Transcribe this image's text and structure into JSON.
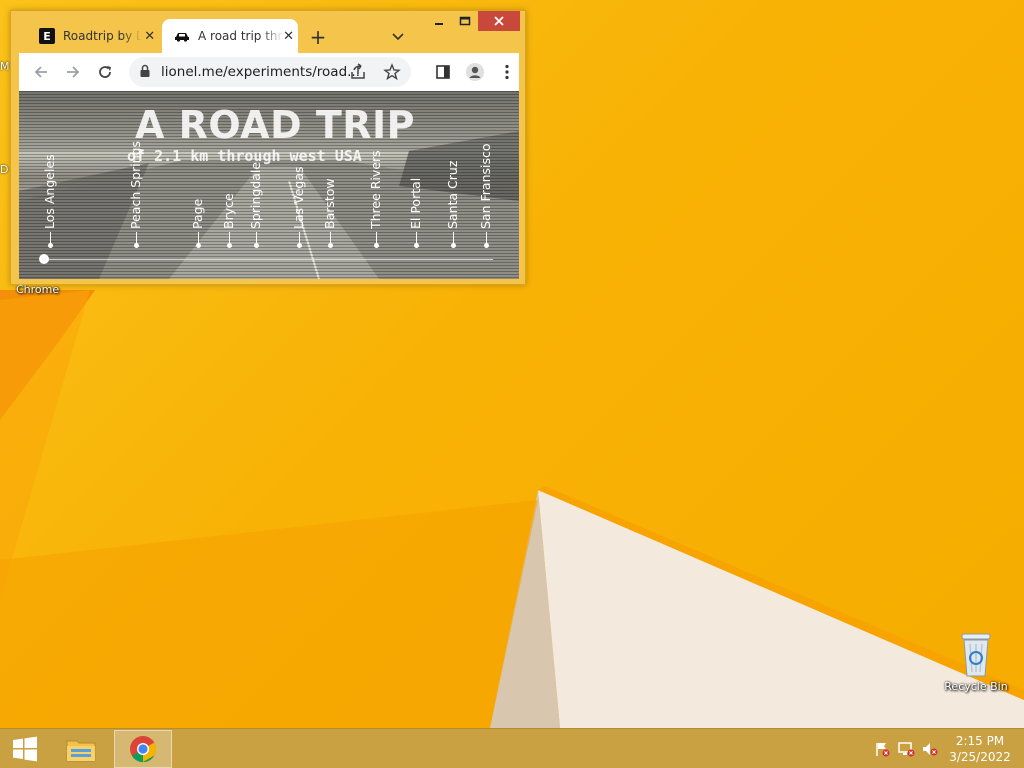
{
  "desktop": {
    "recycle_bin_label": "Recycle Bin",
    "chrome_label": "Chrome",
    "edge_letters": [
      "M",
      "D"
    ]
  },
  "browser": {
    "tabs": [
      {
        "favicon_letter": "E",
        "title": "Roadtrip by Lionel",
        "active": false
      },
      {
        "title": "A road trip through west USA",
        "active": true
      }
    ],
    "new_tab_symbol": "+",
    "url": "lionel.me/experiments/road..."
  },
  "page": {
    "title": "A ROAD TRIP",
    "subtitle": "of 2.1 km through west USA",
    "cities": [
      "Los Angeles",
      "Peach Springs",
      "Page",
      "Bryce",
      "Springdale",
      "Las Vegas",
      "Barstow",
      "Three Rivers",
      "El Portal",
      "Santa Cruz",
      "San Fransisco"
    ]
  },
  "taskbar": {
    "time": "2:15 PM",
    "date": "3/25/2022"
  },
  "colors": {
    "wallpaper": "#f8b205",
    "window_frame": "#f5c54b",
    "close_button": "#c9483c",
    "taskbar": "#c9a143"
  }
}
